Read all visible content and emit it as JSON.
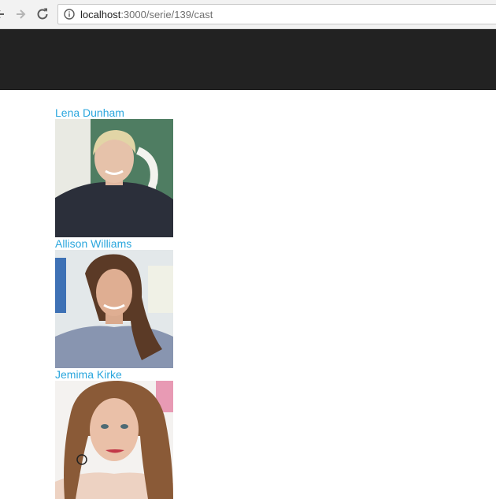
{
  "browser": {
    "url_host": "localhost",
    "url_path": ":3000/serie/139/cast"
  },
  "cast": [
    {
      "name": "Lena Dunham"
    },
    {
      "name": "Allison Williams"
    },
    {
      "name": "Jemima Kirke"
    }
  ],
  "colors": {
    "header": "#222222",
    "link": "#2aa6dd"
  }
}
